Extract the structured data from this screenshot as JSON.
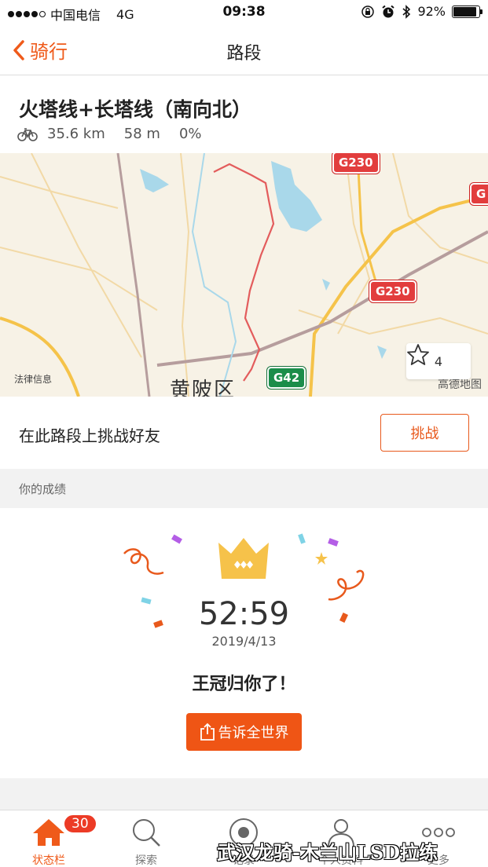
{
  "status_bar": {
    "carrier": "中国电信",
    "network": "4G",
    "time": "09:38",
    "battery": "92%",
    "battery_level": 0.92
  },
  "nav": {
    "back_label": "骑行",
    "title": "路段"
  },
  "segment": {
    "name": "火塔线+长塔线（南向北）",
    "distance": "35.6 km",
    "elevation": "58 m",
    "grade": "0%"
  },
  "map": {
    "legal_text": "法律信息",
    "brand": "高德地图",
    "district": "黄陂区",
    "highways": [
      "G230",
      "G230",
      "G42",
      "G"
    ],
    "star_count": "4"
  },
  "challenge": {
    "text": "在此路段上挑战好友",
    "button": "挑战"
  },
  "results": {
    "section_title": "你的成绩",
    "time": "52:59",
    "date": "2019/4/13",
    "message": "王冠归你了！",
    "share_button": "告诉全世界"
  },
  "tabs": [
    {
      "label": "状态栏",
      "icon": "home-icon",
      "badge": "30"
    },
    {
      "label": "探索",
      "icon": "search-icon"
    },
    {
      "label": "记录",
      "icon": "record-icon"
    },
    {
      "label": "个人资料",
      "icon": "profile-icon"
    },
    {
      "label": "更多",
      "icon": "more-icon"
    }
  ],
  "watermark": "武汉龙骑-木兰山LSD拉练",
  "colors": {
    "accent": "#ef5a1a",
    "crown": "#f6c24a",
    "route": "#e35c5c",
    "badge": "#ec3b26"
  }
}
